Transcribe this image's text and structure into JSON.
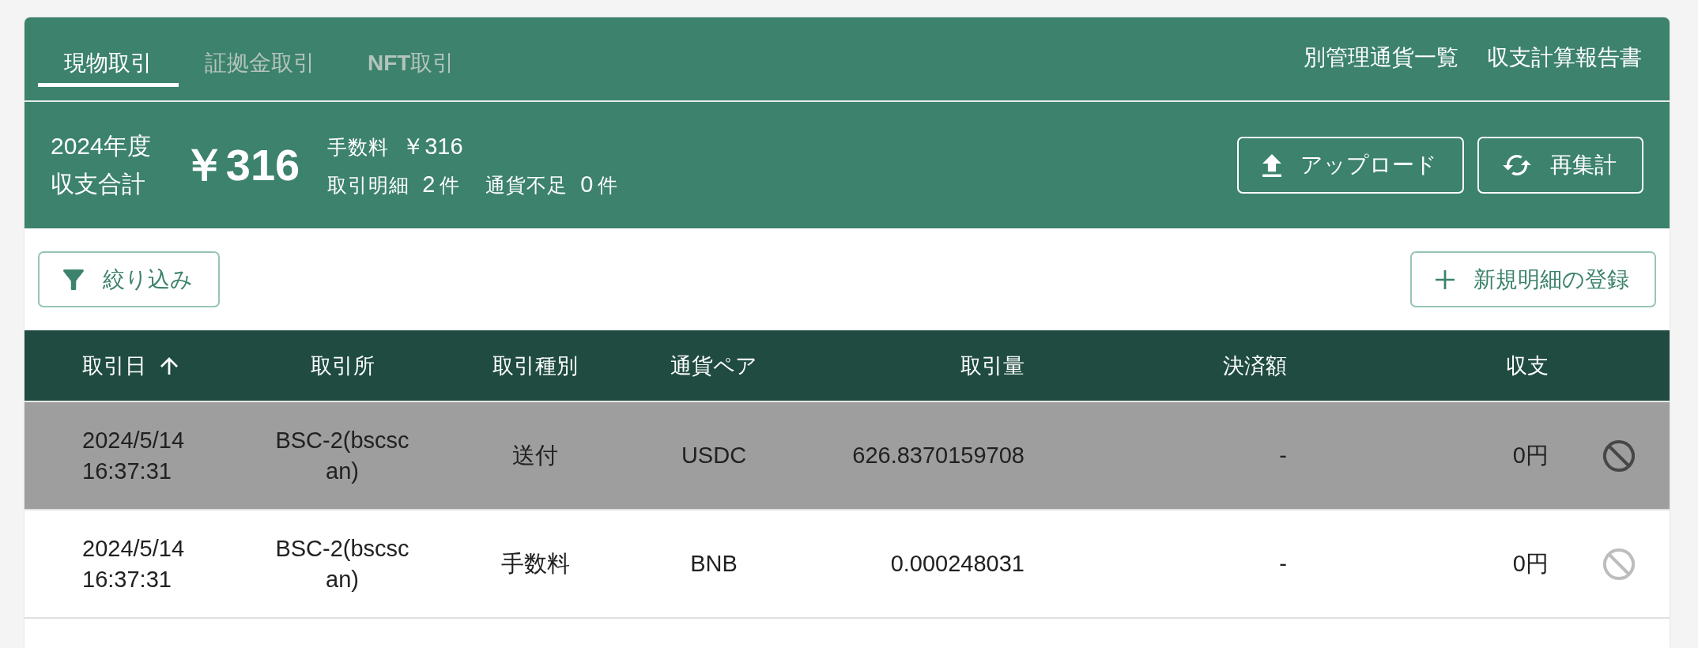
{
  "tabs": [
    {
      "label": "現物取引",
      "selected": true
    },
    {
      "label": "証拠金取引",
      "selected": false
    },
    {
      "label": "**NFT**取引",
      "selected": false
    }
  ],
  "header_links": [
    "別管理通貨一覧",
    "収支計算報告書"
  ],
  "summary": {
    "period": "2024年度",
    "label": "収支合計",
    "total": "￥316",
    "fee": {
      "label": "手数料",
      "value": "￥316"
    },
    "counts": [
      {
        "label": "取引明細",
        "value": "2",
        "unit": "件"
      },
      {
        "label": "通貨不足",
        "value": "0",
        "unit": "件"
      }
    ],
    "upload_button": "アップロード",
    "recalculate_button": "再集計"
  },
  "toolbar": {
    "filter_button": "絞り込み",
    "add_button": "新規明細の登録"
  },
  "table": {
    "columns": [
      {
        "label": "取引日",
        "sorted": true
      },
      {
        "label": "取引所",
        "sorted": false
      },
      {
        "label": "取引種別",
        "sorted": false
      },
      {
        "label": "通貨ペア",
        "sorted": false
      },
      {
        "label": "取引量",
        "sorted": false
      },
      {
        "label": "決済額",
        "sorted": false
      },
      {
        "label": "収支",
        "sorted": false
      }
    ],
    "rows": [
      {
        "date": "2024/5/14 16:37:31",
        "exchange": "BSC-2(bscscan)",
        "type": "送付",
        "pair": "USDC",
        "amount": "626.8370159708",
        "settlement": "-",
        "pnl": "0円",
        "excluded": true
      },
      {
        "date": "2024/5/14 16:37:31",
        "exchange": "BSC-2(bscscan)",
        "type": "手数料",
        "pair": "BNB",
        "amount": "0.000248031",
        "settlement": "-",
        "pnl": "0円",
        "excluded": false
      }
    ]
  }
}
